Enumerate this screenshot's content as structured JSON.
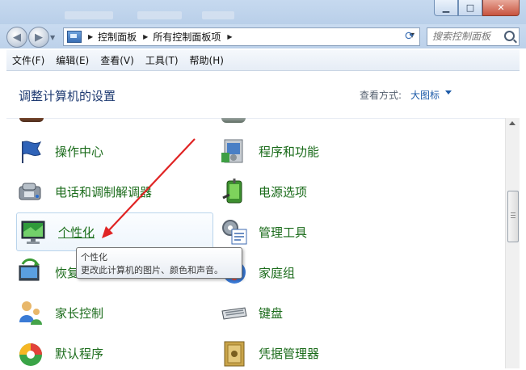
{
  "navigation": {
    "breadcrumbs": [
      "控制面板",
      "所有控制面板项"
    ],
    "search_placeholder": "搜索控制面板"
  },
  "menu": [
    "文件(F)",
    "编辑(E)",
    "查看(V)",
    "工具(T)",
    "帮助(H)"
  ],
  "header": {
    "title": "调整计算机的设置",
    "view_label": "查看方式:",
    "view_value": "大图标"
  },
  "items_left": [
    {
      "label": "操作中心",
      "icon": "action-center-flag-icon"
    },
    {
      "label": "电话和调制解调器",
      "icon": "phone-modem-icon"
    },
    {
      "label": "个性化",
      "icon": "personalization-monitor-icon"
    },
    {
      "label": "恢复",
      "icon": "recovery-icon"
    },
    {
      "label": "家长控制",
      "icon": "parental-controls-icon"
    },
    {
      "label": "默认程序",
      "icon": "default-programs-icon"
    }
  ],
  "items_right": [
    {
      "label": "程序和功能",
      "icon": "programs-features-icon"
    },
    {
      "label": "电源选项",
      "icon": "power-options-icon"
    },
    {
      "label": "管理工具",
      "icon": "administrative-tools-icon"
    },
    {
      "label": "家庭组",
      "icon": "homegroup-icon"
    },
    {
      "label": "键盘",
      "icon": "keyboard-icon"
    },
    {
      "label": "凭据管理器",
      "icon": "credential-manager-icon"
    }
  ],
  "tooltip": {
    "title": "个性化",
    "description": "更改此计算机的图片、颜色和声音。"
  },
  "annotation": {
    "arrow_color": "#e02424"
  },
  "colors": {
    "link_green": "#1a6b1a",
    "title_blue": "#1f3b72"
  }
}
